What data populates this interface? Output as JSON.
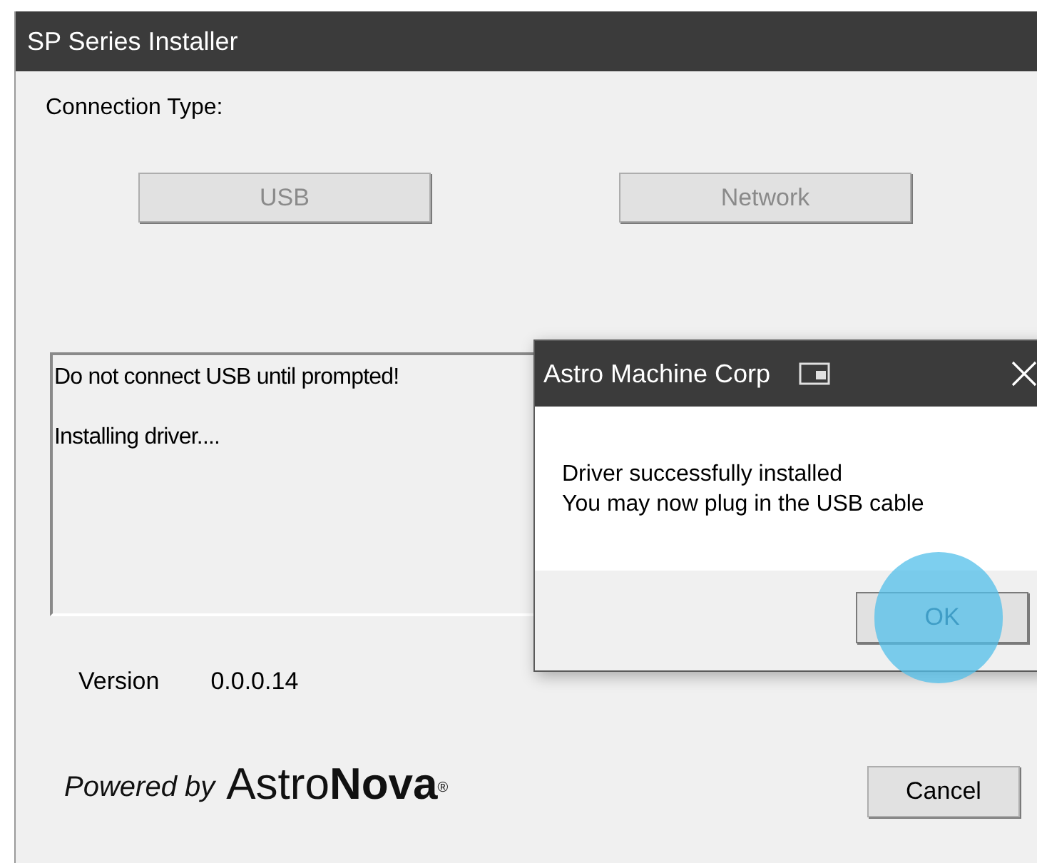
{
  "window": {
    "title": "SP Series Installer"
  },
  "connection": {
    "label": "Connection Type:",
    "buttons": [
      {
        "label": "USB",
        "disabled": true
      },
      {
        "label": "Network",
        "disabled": true
      }
    ]
  },
  "log": {
    "lines": [
      "Do not connect USB until prompted!",
      "Installing driver...."
    ]
  },
  "version": {
    "label": "Version",
    "value": "0.0.0.14"
  },
  "branding": {
    "prefix": "Powered by",
    "brand": "Astro**Nova**",
    "mark": "®"
  },
  "cancel_button": {
    "label": "Cancel"
  },
  "dialog": {
    "title": "Astro Machine Corp",
    "message": [
      "Driver successfully installed",
      "You may now plug in the USB cable"
    ],
    "ok_button": {
      "label": "OK",
      "touched": true
    }
  }
}
